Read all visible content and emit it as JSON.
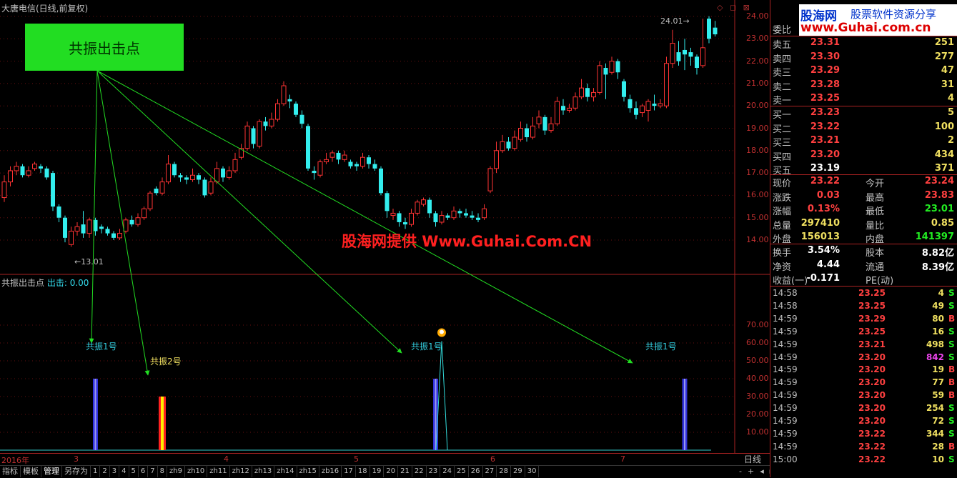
{
  "window": {
    "title": "大唐电信(日线,前复权)",
    "controls": "◇ ◻ ⊠"
  },
  "annotation": {
    "box_label": "共振出击点",
    "watermark": "股海网提供 Www.Guhai.Com.CN"
  },
  "price_axis": [
    "24.00",
    "23.00",
    "22.00",
    "21.00",
    "20.00",
    "19.00",
    "18.00",
    "17.00",
    "16.00",
    "15.00",
    "14.00"
  ],
  "price_marks": {
    "high": "24.01",
    "low": "13.01"
  },
  "indicator": {
    "name": "共振出击点",
    "signal_label": "出击:",
    "signal_value": "0.00",
    "axis": [
      "70.00",
      "60.00",
      "50.00",
      "40.00",
      "30.00",
      "20.00",
      "10.00"
    ],
    "labels": [
      {
        "text": "共振1号",
        "color": "cyan"
      },
      {
        "text": "共振2号",
        "color": "yellow"
      },
      {
        "text": "共振1号",
        "color": "cyan"
      },
      {
        "text": "共振1号",
        "color": "cyan"
      }
    ]
  },
  "date_axis": [
    "2016年",
    "3",
    "4",
    "5",
    "6",
    "7"
  ],
  "period": "日线",
  "tabs": [
    "指标",
    "模板",
    "管理",
    "另存为",
    "1",
    "2",
    "3",
    "4",
    "5",
    "6",
    "7",
    "8",
    "zh9",
    "zh10",
    "zh11",
    "zh12",
    "zh13",
    "zh14",
    "zh15",
    "zb16",
    "17",
    "18",
    "19",
    "20",
    "21",
    "22",
    "23",
    "24",
    "25",
    "26",
    "27",
    "28",
    "29",
    "30"
  ],
  "active_tab": "管理",
  "scroll": {
    "minus": "-",
    "plus": "+",
    "left": "◂",
    "right": "▸"
  },
  "logo": {
    "brand": "股海网",
    "slogan": "股票软件资源分享",
    "url": "www.Guhai.com.cn"
  },
  "order_book": {
    "header": "委比",
    "asks": [
      {
        "label": "卖五",
        "price": "23.31",
        "qty": "251"
      },
      {
        "label": "卖四",
        "price": "23.30",
        "qty": "277"
      },
      {
        "label": "卖三",
        "price": "23.29",
        "qty": "47"
      },
      {
        "label": "卖二",
        "price": "23.28",
        "qty": "31"
      },
      {
        "label": "卖一",
        "price": "23.25",
        "qty": "4"
      }
    ],
    "bids": [
      {
        "label": "买一",
        "price": "23.23",
        "qty": "5"
      },
      {
        "label": "买二",
        "price": "23.22",
        "qty": "100"
      },
      {
        "label": "买三",
        "price": "23.21",
        "qty": "2"
      },
      {
        "label": "买四",
        "price": "23.20",
        "qty": "434"
      },
      {
        "label": "买五",
        "price": "23.19",
        "qty": "371"
      }
    ]
  },
  "quote": [
    {
      "k1": "现价",
      "v1": "23.22",
      "k2": "今开",
      "v2": "23.24"
    },
    {
      "k1": "涨跌",
      "v1": "0.03",
      "k2": "最高",
      "v2": "23.83"
    },
    {
      "k1": "涨幅",
      "v1": "0.13%",
      "k2": "最低",
      "v2": "23.01"
    },
    {
      "k1": "总量",
      "v1": "297410",
      "k2": "量比",
      "v2": "0.85"
    },
    {
      "k1": "外盘",
      "v1": "156013",
      "k2": "内盘",
      "v2": "141397"
    }
  ],
  "fund": [
    {
      "k1": "换手",
      "v1": "3.54%",
      "k2": "股本",
      "v2": "8.82亿"
    },
    {
      "k1": "净资",
      "v1": "4.44",
      "k2": "流通",
      "v2": "8.39亿"
    },
    {
      "k1": "收益(一)",
      "v1": "-0.171",
      "k2": "PE(动)",
      "v2": ""
    }
  ],
  "ticks": [
    {
      "time": "14:58",
      "price": "23.25",
      "qty": "4",
      "side": "S"
    },
    {
      "time": "14:58",
      "price": "23.25",
      "qty": "49",
      "side": "S"
    },
    {
      "time": "14:59",
      "price": "23.29",
      "qty": "80",
      "side": "B"
    },
    {
      "time": "14:59",
      "price": "23.25",
      "qty": "16",
      "side": "S"
    },
    {
      "time": "14:59",
      "price": "23.21",
      "qty": "498",
      "side": "S"
    },
    {
      "time": "14:59",
      "price": "23.20",
      "qty": "842",
      "side": "S"
    },
    {
      "time": "14:59",
      "price": "23.20",
      "qty": "19",
      "side": "B"
    },
    {
      "time": "14:59",
      "price": "23.20",
      "qty": "77",
      "side": "B"
    },
    {
      "time": "14:59",
      "price": "23.20",
      "qty": "59",
      "side": "B"
    },
    {
      "time": "14:59",
      "price": "23.20",
      "qty": "254",
      "side": "S"
    },
    {
      "time": "14:59",
      "price": "23.20",
      "qty": "72",
      "side": "S"
    },
    {
      "time": "14:59",
      "price": "23.22",
      "qty": "344",
      "side": "S"
    },
    {
      "time": "14:59",
      "price": "23.22",
      "qty": "28",
      "side": "B"
    },
    {
      "time": "15:00",
      "price": "23.22",
      "qty": "10",
      "side": "S"
    }
  ],
  "chart_data": {
    "type": "candlestick",
    "ylim": [
      13.4,
      24.4
    ],
    "candles": [
      [
        15.9,
        16.6,
        16.9,
        15.7
      ],
      [
        16.6,
        17.1,
        17.3,
        16.4
      ],
      [
        17.1,
        17.3,
        17.5,
        16.9
      ],
      [
        17.3,
        16.9,
        17.4,
        16.8
      ],
      [
        16.9,
        17.1,
        17.3,
        16.8
      ],
      [
        17.2,
        17.4,
        17.5,
        17.1
      ],
      [
        17.3,
        17.2,
        17.4,
        17.0
      ],
      [
        17.2,
        16.8,
        17.3,
        16.7
      ],
      [
        17.0,
        15.5,
        17.1,
        15.3
      ],
      [
        15.5,
        15.0,
        15.6,
        14.8
      ],
      [
        15.0,
        14.1,
        15.1,
        13.9
      ],
      [
        13.8,
        14.4,
        14.6,
        13.7
      ],
      [
        14.4,
        14.6,
        14.8,
        14.2
      ],
      [
        14.7,
        14.3,
        15.3,
        14.1
      ],
      [
        14.3,
        14.9,
        15.0,
        14.1
      ],
      [
        14.9,
        14.4,
        15.0,
        14.2
      ],
      [
        14.6,
        14.5,
        14.7,
        14.3
      ],
      [
        14.5,
        14.3,
        14.6,
        14.2
      ],
      [
        14.3,
        14.1,
        14.4,
        14.0
      ],
      [
        14.1,
        14.3,
        14.5,
        14.0
      ],
      [
        14.4,
        14.9,
        15.0,
        14.3
      ],
      [
        14.9,
        14.7,
        15.1,
        14.6
      ],
      [
        14.7,
        15.0,
        15.2,
        14.6
      ],
      [
        15.0,
        15.4,
        15.5,
        14.9
      ],
      [
        15.4,
        16.1,
        16.2,
        15.3
      ],
      [
        16.3,
        16.1,
        16.4,
        16.0
      ],
      [
        16.1,
        16.6,
        16.8,
        16.0
      ],
      [
        16.6,
        17.4,
        17.8,
        16.5
      ],
      [
        17.4,
        16.9,
        17.5,
        16.8
      ],
      [
        16.9,
        16.8,
        17.0,
        16.6
      ],
      [
        16.8,
        16.7,
        16.9,
        16.5
      ],
      [
        16.7,
        16.9,
        17.2,
        16.6
      ],
      [
        16.9,
        16.7,
        17.0,
        16.5
      ],
      [
        16.7,
        16.0,
        16.8,
        15.9
      ],
      [
        16.1,
        16.6,
        16.8,
        16.0
      ],
      [
        16.6,
        17.2,
        17.5,
        16.5
      ],
      [
        17.2,
        16.8,
        17.3,
        16.6
      ],
      [
        16.8,
        17.1,
        17.3,
        16.7
      ],
      [
        17.1,
        17.6,
        17.9,
        17.0
      ],
      [
        17.7,
        18.1,
        18.3,
        17.6
      ],
      [
        18.1,
        19.1,
        19.3,
        18.0
      ],
      [
        19.0,
        18.3,
        19.1,
        18.1
      ],
      [
        18.2,
        19.3,
        19.4,
        18.1
      ],
      [
        19.3,
        19.1,
        19.5,
        18.9
      ],
      [
        19.1,
        19.4,
        19.7,
        19.0
      ],
      [
        19.4,
        20.1,
        20.3,
        19.3
      ],
      [
        20.1,
        20.9,
        21.1,
        20.0
      ],
      [
        20.3,
        20.2,
        20.5,
        19.9
      ],
      [
        20.1,
        19.6,
        20.2,
        19.5
      ],
      [
        19.6,
        19.2,
        19.8,
        19.0
      ],
      [
        19.1,
        17.2,
        19.2,
        17.1
      ],
      [
        17.1,
        17.0,
        17.3,
        16.7
      ],
      [
        16.9,
        17.5,
        17.6,
        16.8
      ],
      [
        17.5,
        17.6,
        17.9,
        17.4
      ],
      [
        17.7,
        17.9,
        18.0,
        17.5
      ],
      [
        17.9,
        17.6,
        18.0,
        17.4
      ],
      [
        17.6,
        17.8,
        18.0,
        17.5
      ],
      [
        17.5,
        17.3,
        17.6,
        17.2
      ],
      [
        17.4,
        17.3,
        17.5,
        17.1
      ],
      [
        17.3,
        17.7,
        17.9,
        17.2
      ],
      [
        17.7,
        17.4,
        17.8,
        17.2
      ],
      [
        17.4,
        17.2,
        17.6,
        17.1
      ],
      [
        17.2,
        16.1,
        17.3,
        16.0
      ],
      [
        16.1,
        15.3,
        16.2,
        15.0
      ],
      [
        15.1,
        15.2,
        15.4,
        14.9
      ],
      [
        15.2,
        14.8,
        15.3,
        14.6
      ],
      [
        14.8,
        14.7,
        15.0,
        14.5
      ],
      [
        14.7,
        15.2,
        15.4,
        14.6
      ],
      [
        15.2,
        15.7,
        15.8,
        15.1
      ],
      [
        15.6,
        15.8,
        15.9,
        15.5
      ],
      [
        15.8,
        15.2,
        15.9,
        15.0
      ],
      [
        15.2,
        14.8,
        15.3,
        14.6
      ],
      [
        14.8,
        15.1,
        15.3,
        14.7
      ],
      [
        15.1,
        15.0,
        15.2,
        14.9
      ],
      [
        15.0,
        15.3,
        15.5,
        14.9
      ],
      [
        15.3,
        15.2,
        15.4,
        15.0
      ],
      [
        15.2,
        15.1,
        15.4,
        15.0
      ],
      [
        15.1,
        15.0,
        15.3,
        14.9
      ],
      [
        15.0,
        14.9,
        15.2,
        14.8
      ],
      [
        15.0,
        15.4,
        15.6,
        14.9
      ],
      [
        16.2,
        17.2,
        17.3,
        16.1
      ],
      [
        17.2,
        18.0,
        18.4,
        17.0
      ],
      [
        18.0,
        18.4,
        18.7,
        17.9
      ],
      [
        18.4,
        18.1,
        18.6,
        18.0
      ],
      [
        18.1,
        18.6,
        18.9,
        18.0
      ],
      [
        18.5,
        19.0,
        19.3,
        18.4
      ],
      [
        19.0,
        18.6,
        19.2,
        18.4
      ],
      [
        18.6,
        19.1,
        19.5,
        18.5
      ],
      [
        19.2,
        19.5,
        19.8,
        19.0
      ],
      [
        19.5,
        18.9,
        19.6,
        18.7
      ],
      [
        18.9,
        19.2,
        19.5,
        18.8
      ],
      [
        19.2,
        20.2,
        20.4,
        19.1
      ],
      [
        20.0,
        19.8,
        20.3,
        19.6
      ],
      [
        19.8,
        19.9,
        20.1,
        19.7
      ],
      [
        19.9,
        20.4,
        20.6,
        19.8
      ],
      [
        20.4,
        20.8,
        21.2,
        20.3
      ],
      [
        20.8,
        20.4,
        21.0,
        20.2
      ],
      [
        20.4,
        20.6,
        20.8,
        20.2
      ],
      [
        20.6,
        21.8,
        22.0,
        20.5
      ],
      [
        21.7,
        21.4,
        21.9,
        20.3
      ],
      [
        21.5,
        22.0,
        22.2,
        21.4
      ],
      [
        22.0,
        21.5,
        22.1,
        21.2
      ],
      [
        21.1,
        20.4,
        21.2,
        20.2
      ],
      [
        20.3,
        19.9,
        20.5,
        19.7
      ],
      [
        19.9,
        19.6,
        20.2,
        19.4
      ],
      [
        19.7,
        20.0,
        20.1,
        19.5
      ],
      [
        19.8,
        20.2,
        20.3,
        19.3
      ],
      [
        20.1,
        20.0,
        20.5,
        19.8
      ],
      [
        20.0,
        20.1,
        20.3,
        19.9
      ],
      [
        20.0,
        21.9,
        22.2,
        19.9
      ],
      [
        21.9,
        22.8,
        23.4,
        21.7
      ],
      [
        22.4,
        22.0,
        22.9,
        21.8
      ],
      [
        22.5,
        22.3,
        23.0,
        21.6
      ],
      [
        22.4,
        22.2,
        22.6,
        21.8
      ],
      [
        22.2,
        21.7,
        22.3,
        21.4
      ],
      [
        21.8,
        22.6,
        23.9,
        21.7
      ],
      [
        23.9,
        23.0,
        24.01,
        22.8
      ],
      [
        23.5,
        23.2,
        23.8,
        23.1
      ]
    ],
    "signals": [
      {
        "bar": 15,
        "value": 40,
        "type": "resonance-1"
      },
      {
        "bar": 26,
        "value": 30,
        "type": "resonance-2"
      },
      {
        "bar": 71,
        "value": 40,
        "type": "resonance-1"
      },
      {
        "bar": 112,
        "value": 40,
        "type": "resonance-1"
      }
    ],
    "indicator_ylim": [
      0,
      80
    ],
    "spike": {
      "bar": 72,
      "value": 61
    }
  }
}
